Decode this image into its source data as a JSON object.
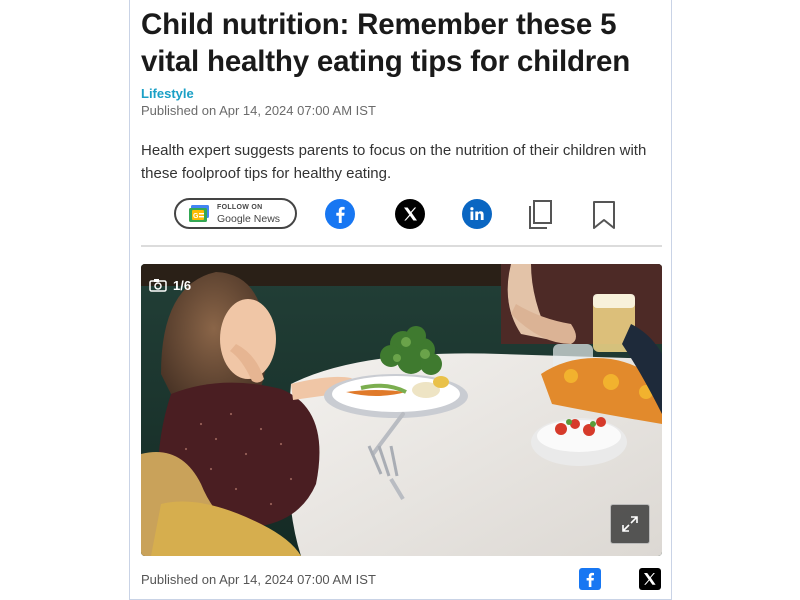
{
  "article": {
    "headline": "Child nutrition: Remember these 5 vital healthy eating tips for children",
    "category": "Lifestyle",
    "published": "Published on Apr 14, 2024 07:00 AM IST",
    "summary": "Health expert suggests parents to focus on the nutrition of their children with these foolproof tips for healthy eating."
  },
  "share": {
    "google_news_small": "FOLLOW ON",
    "google_news_label": "Google News",
    "icons": [
      "google-news-icon",
      "facebook-icon",
      "x-icon",
      "linkedin-icon",
      "copy-icon",
      "bookmark-icon"
    ]
  },
  "gallery": {
    "counter": "1/6",
    "icons": [
      "camera-icon",
      "expand-icon"
    ]
  },
  "footer": {
    "published": "Published on Apr 14, 2024 07:00 AM IST",
    "icons": [
      "facebook-icon",
      "x-icon"
    ]
  },
  "colors": {
    "category": "#1aa0c6",
    "facebook": "#1877f2",
    "linkedin": "#0a66c2",
    "x": "#000000"
  }
}
